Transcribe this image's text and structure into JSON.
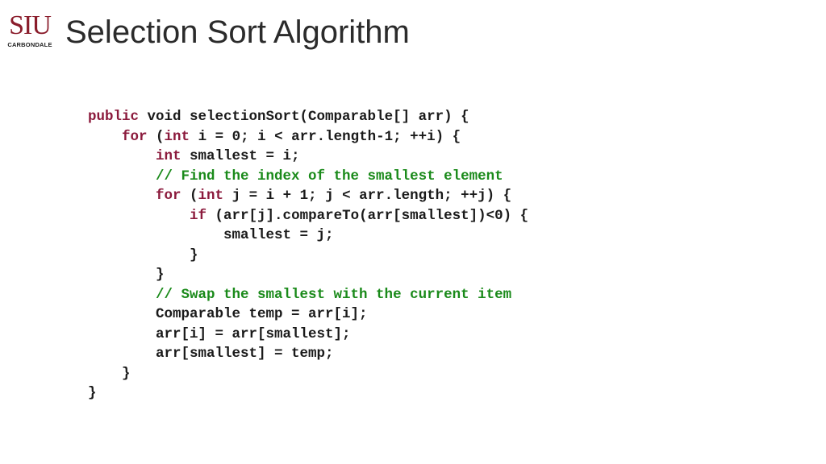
{
  "logo": {
    "mark": "SIU",
    "subtitle": "CARBONDALE",
    "color": "#8a1c2b"
  },
  "slide": {
    "title": "Selection Sort Algorithm"
  },
  "colors": {
    "keyword": "#8b1a3c",
    "comment": "#1a8a1a",
    "text": "#1a1a1a"
  },
  "code": {
    "lines": [
      {
        "indent": 0,
        "tokens": [
          {
            "t": "kw",
            "v": "public"
          },
          {
            "t": "tx",
            "v": " void selectionSort(Comparable[] arr) {"
          }
        ]
      },
      {
        "indent": 1,
        "tokens": [
          {
            "t": "kw",
            "v": "for"
          },
          {
            "t": "tx",
            "v": " ("
          },
          {
            "t": "kw",
            "v": "int"
          },
          {
            "t": "tx",
            "v": " i = 0; i < arr.length-1; ++i) {"
          }
        ]
      },
      {
        "indent": 2,
        "tokens": [
          {
            "t": "kw",
            "v": "int"
          },
          {
            "t": "tx",
            "v": " smallest = i;"
          }
        ]
      },
      {
        "indent": 2,
        "tokens": [
          {
            "t": "cm",
            "v": "// Find the index of the smallest element"
          }
        ]
      },
      {
        "indent": 2,
        "tokens": [
          {
            "t": "kw",
            "v": "for"
          },
          {
            "t": "tx",
            "v": " ("
          },
          {
            "t": "kw",
            "v": "int"
          },
          {
            "t": "tx",
            "v": " j = i + 1; j < arr.length; ++j) {"
          }
        ]
      },
      {
        "indent": 3,
        "tokens": [
          {
            "t": "kw",
            "v": "if"
          },
          {
            "t": "tx",
            "v": " (arr[j].compareTo(arr[smallest])<0) {"
          }
        ]
      },
      {
        "indent": 4,
        "tokens": [
          {
            "t": "tx",
            "v": "smallest = j;"
          }
        ]
      },
      {
        "indent": 3,
        "tokens": [
          {
            "t": "tx",
            "v": "}"
          }
        ]
      },
      {
        "indent": 2,
        "tokens": [
          {
            "t": "tx",
            "v": "}"
          }
        ]
      },
      {
        "indent": 2,
        "tokens": [
          {
            "t": "cm",
            "v": "// Swap the smallest with the current item"
          }
        ]
      },
      {
        "indent": 2,
        "tokens": [
          {
            "t": "tx",
            "v": "Comparable temp = arr[i];"
          }
        ]
      },
      {
        "indent": 2,
        "tokens": [
          {
            "t": "tx",
            "v": "arr[i] = arr[smallest];"
          }
        ]
      },
      {
        "indent": 2,
        "tokens": [
          {
            "t": "tx",
            "v": "arr[smallest] = temp;"
          }
        ]
      },
      {
        "indent": 1,
        "tokens": [
          {
            "t": "tx",
            "v": "}"
          }
        ]
      },
      {
        "indent": 0,
        "tokens": [
          {
            "t": "tx",
            "v": "}"
          }
        ]
      }
    ]
  }
}
